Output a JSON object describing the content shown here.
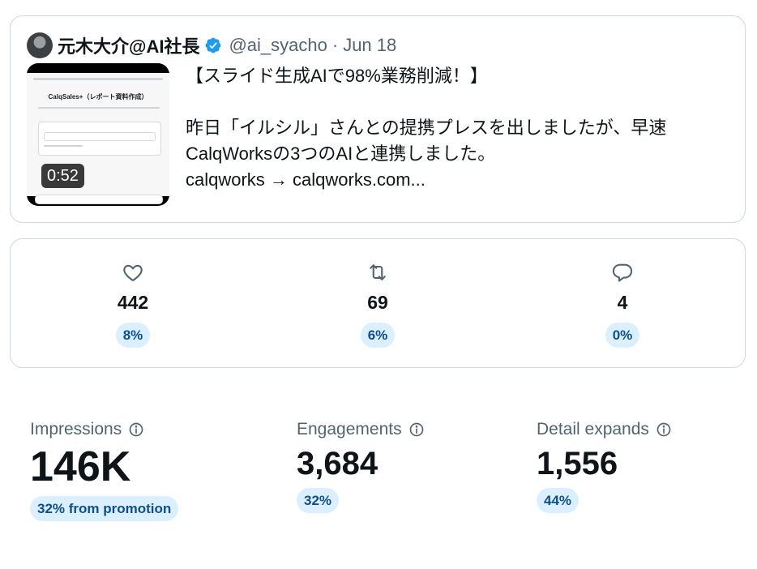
{
  "tweet": {
    "author_name": "元木大介@AI社長",
    "handle": "@ai_syacho",
    "separator": "·",
    "date": "Jun 18",
    "text_line1": "【スライド生成AIで98%業務削減！】",
    "text_line2": "昨日「イルシル」さんとの提携プレスを出しましたが、早速",
    "text_line3": "CalqWorksの3つのAIと連携しました。",
    "text_line4": "calqworks → calqworks.com...",
    "video": {
      "duration": "0:52",
      "thumbnail_title": "CalqSales+（レポート資料作成）"
    },
    "verified_color": "#1d9bf0"
  },
  "metrics": [
    {
      "icon": "heart-icon",
      "value": "442",
      "percent": "8%"
    },
    {
      "icon": "retweet-icon",
      "value": "69",
      "percent": "6%"
    },
    {
      "icon": "reply-icon",
      "value": "4",
      "percent": "0%"
    }
  ],
  "stats": {
    "impressions": {
      "label": "Impressions",
      "value": "146K",
      "badge": "32% from promotion"
    },
    "engagements": {
      "label": "Engagements",
      "value": "3,684",
      "badge": "32%"
    },
    "detail_expands": {
      "label": "Detail expands",
      "value": "1,556",
      "badge": "44%"
    }
  },
  "colors": {
    "text": "#0f1419",
    "secondary_text": "#536471",
    "border": "#cfd9de",
    "pill_bg": "#dbefff",
    "pill_text": "#0e4f8a"
  }
}
